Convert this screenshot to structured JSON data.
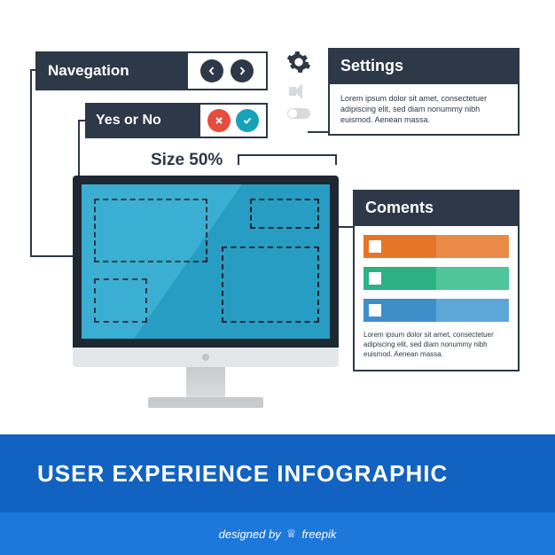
{
  "navigation": {
    "label": "Navegation"
  },
  "yesno": {
    "label": "Yes or No"
  },
  "size": {
    "label": "Size 50%"
  },
  "settings": {
    "title": "Settings",
    "text": "Lorem ipsum dolor sit amet, consectetuer adipiscing elit, sed diam nonummy nibh euismod. Aenean massa."
  },
  "comments": {
    "title": "Coments",
    "text": "Lorem ipsum dolor sit amet, consectetuer adipiscing elit, sed diam nonummy nibh euismod. Aenean massa."
  },
  "footer": {
    "title": "USER EXPERIENCE INFOGRAPHIC",
    "credit_prefix": "designed by",
    "credit_name": "freepik"
  }
}
